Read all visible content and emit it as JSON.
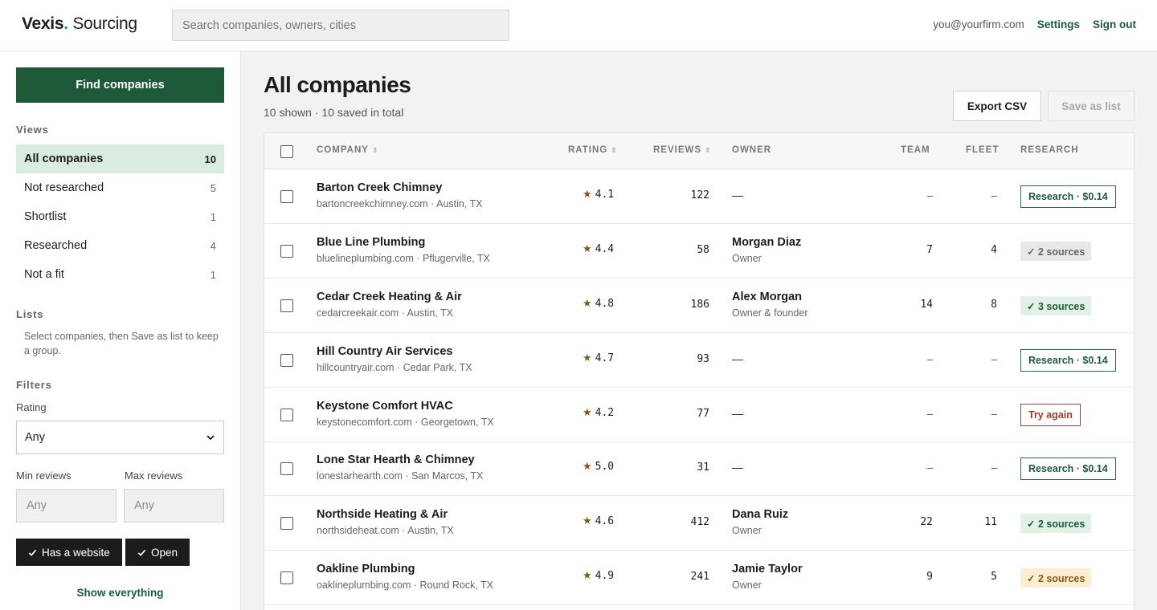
{
  "header": {
    "brand_bold": "Vexis",
    "brand_dot": ".",
    "brand_rest": " Sourcing",
    "search_placeholder": "Search companies, owners, cities",
    "email": "you@yourfirm.com",
    "settings": "Settings",
    "sign_out": "Sign out"
  },
  "sidebar": {
    "find_button": "Find companies",
    "views_title": "Views",
    "views": [
      {
        "label": "All companies",
        "count": "10"
      },
      {
        "label": "Not researched",
        "count": "5"
      },
      {
        "label": "Shortlist",
        "count": "1"
      },
      {
        "label": "Researched",
        "count": "4"
      },
      {
        "label": "Not a fit",
        "count": "1"
      }
    ],
    "lists_title": "Lists",
    "lists_note": "Select companies, then Save as list to keep a group.",
    "filters_title": "Filters",
    "rating_label": "Rating",
    "rating_value": "Any",
    "min_reviews_label": "Min reviews",
    "max_reviews_label": "Max reviews",
    "min_placeholder": "Any",
    "max_placeholder": "Any",
    "chip_website": "Has a website",
    "chip_open": "Open",
    "show_everything": "Show everything"
  },
  "main": {
    "title": "All companies",
    "subtitle": "10 shown · 10 saved in total",
    "export_button": "Export CSV",
    "save_list_button": "Save as list"
  },
  "table": {
    "headers": {
      "company": "COMPANY",
      "rating": "RATING",
      "reviews": "REVIEWS",
      "owner": "OWNER",
      "team": "TEAM",
      "fleet": "FLEET",
      "research": "RESEARCH"
    },
    "rows": [
      {
        "name": "Barton Creek Chimney",
        "sub": "bartoncreekchimney.com · Austin, TX",
        "rating": "4.1",
        "reviews": "122",
        "owner": "—",
        "role": "",
        "team": "–",
        "fleet": "–",
        "research": "Research · $0.14",
        "research_kind": "button"
      },
      {
        "name": "Blue Line Plumbing",
        "sub": "bluelineplumbing.com · Pflugerville, TX",
        "rating": "4.4",
        "reviews": "58",
        "owner": "Morgan Diaz",
        "role": "Owner",
        "team": "7",
        "fleet": "4",
        "research": "✓ 2 sources",
        "research_kind": "grey"
      },
      {
        "name": "Cedar Creek Heating & Air",
        "sub": "cedarcreekair.com · Austin, TX",
        "rating": "4.8",
        "reviews": "186",
        "owner": "Alex Morgan",
        "role": "Owner & founder",
        "team": "14",
        "fleet": "8",
        "research": "✓ 3 sources",
        "research_kind": "green"
      },
      {
        "name": "Hill Country Air Services",
        "sub": "hillcountryair.com · Cedar Park, TX",
        "rating": "4.7",
        "reviews": "93",
        "owner": "—",
        "role": "",
        "team": "–",
        "fleet": "–",
        "research": "Research · $0.14",
        "research_kind": "button"
      },
      {
        "name": "Keystone Comfort HVAC",
        "sub": "keystonecomfort.com · Georgetown, TX",
        "rating": "4.2",
        "reviews": "77",
        "owner": "—",
        "role": "",
        "team": "–",
        "fleet": "–",
        "research": "Try again",
        "research_kind": "retry"
      },
      {
        "name": "Lone Star Hearth & Chimney",
        "sub": "lonestarhearth.com · San Marcos, TX",
        "rating": "5.0",
        "reviews": "31",
        "owner": "—",
        "role": "",
        "team": "–",
        "fleet": "–",
        "research": "Research · $0.14",
        "research_kind": "button"
      },
      {
        "name": "Northside Heating & Air",
        "sub": "northsideheat.com · Austin, TX",
        "rating": "4.6",
        "reviews": "412",
        "owner": "Dana Ruiz",
        "role": "Owner",
        "team": "22",
        "fleet": "11",
        "research": "✓ 2 sources",
        "research_kind": "green"
      },
      {
        "name": "Oakline Plumbing",
        "sub": "oaklineplumbing.com · Round Rock, TX",
        "rating": "4.9",
        "reviews": "241",
        "owner": "Jamie Taylor",
        "role": "Owner",
        "team": "9",
        "fleet": "5",
        "research": "✓ 2 sources",
        "research_kind": "amber"
      }
    ]
  }
}
